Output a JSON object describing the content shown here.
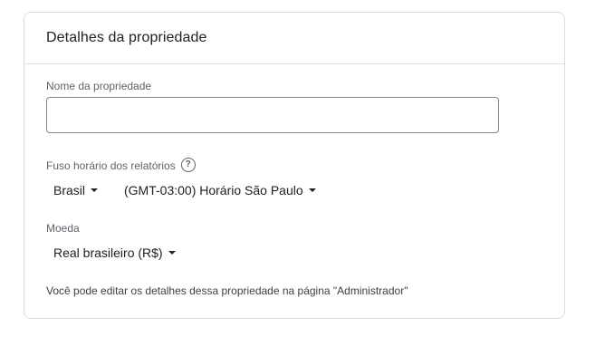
{
  "card": {
    "title": "Detalhes da propriedade"
  },
  "property_name": {
    "label": "Nome da propriedade",
    "value": "",
    "placeholder": ""
  },
  "timezone": {
    "label": "Fuso horário dos relatórios",
    "help_icon": "question-circle-icon",
    "country": "Brasil",
    "zone": "(GMT-03:00) Horário São Paulo"
  },
  "currency": {
    "label": "Moeda",
    "value": "Real brasileiro (R$)"
  },
  "footer": {
    "note": "Você pode editar os detalhes dessa propriedade na página \"Administrador\""
  }
}
